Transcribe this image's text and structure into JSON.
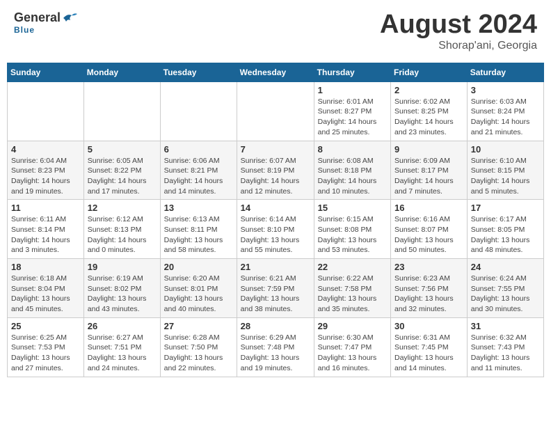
{
  "header": {
    "logo": {
      "general": "General",
      "blue": "Blue"
    },
    "title": "August 2024",
    "location": "Shorap'ani, Georgia"
  },
  "days_of_week": [
    "Sunday",
    "Monday",
    "Tuesday",
    "Wednesday",
    "Thursday",
    "Friday",
    "Saturday"
  ],
  "weeks": [
    [
      {
        "day": "",
        "info": ""
      },
      {
        "day": "",
        "info": ""
      },
      {
        "day": "",
        "info": ""
      },
      {
        "day": "",
        "info": ""
      },
      {
        "day": "1",
        "info": "Sunrise: 6:01 AM\nSunset: 8:27 PM\nDaylight: 14 hours\nand 25 minutes."
      },
      {
        "day": "2",
        "info": "Sunrise: 6:02 AM\nSunset: 8:25 PM\nDaylight: 14 hours\nand 23 minutes."
      },
      {
        "day": "3",
        "info": "Sunrise: 6:03 AM\nSunset: 8:24 PM\nDaylight: 14 hours\nand 21 minutes."
      }
    ],
    [
      {
        "day": "4",
        "info": "Sunrise: 6:04 AM\nSunset: 8:23 PM\nDaylight: 14 hours\nand 19 minutes."
      },
      {
        "day": "5",
        "info": "Sunrise: 6:05 AM\nSunset: 8:22 PM\nDaylight: 14 hours\nand 17 minutes."
      },
      {
        "day": "6",
        "info": "Sunrise: 6:06 AM\nSunset: 8:21 PM\nDaylight: 14 hours\nand 14 minutes."
      },
      {
        "day": "7",
        "info": "Sunrise: 6:07 AM\nSunset: 8:19 PM\nDaylight: 14 hours\nand 12 minutes."
      },
      {
        "day": "8",
        "info": "Sunrise: 6:08 AM\nSunset: 8:18 PM\nDaylight: 14 hours\nand 10 minutes."
      },
      {
        "day": "9",
        "info": "Sunrise: 6:09 AM\nSunset: 8:17 PM\nDaylight: 14 hours\nand 7 minutes."
      },
      {
        "day": "10",
        "info": "Sunrise: 6:10 AM\nSunset: 8:15 PM\nDaylight: 14 hours\nand 5 minutes."
      }
    ],
    [
      {
        "day": "11",
        "info": "Sunrise: 6:11 AM\nSunset: 8:14 PM\nDaylight: 14 hours\nand 3 minutes."
      },
      {
        "day": "12",
        "info": "Sunrise: 6:12 AM\nSunset: 8:13 PM\nDaylight: 14 hours\nand 0 minutes."
      },
      {
        "day": "13",
        "info": "Sunrise: 6:13 AM\nSunset: 8:11 PM\nDaylight: 13 hours\nand 58 minutes."
      },
      {
        "day": "14",
        "info": "Sunrise: 6:14 AM\nSunset: 8:10 PM\nDaylight: 13 hours\nand 55 minutes."
      },
      {
        "day": "15",
        "info": "Sunrise: 6:15 AM\nSunset: 8:08 PM\nDaylight: 13 hours\nand 53 minutes."
      },
      {
        "day": "16",
        "info": "Sunrise: 6:16 AM\nSunset: 8:07 PM\nDaylight: 13 hours\nand 50 minutes."
      },
      {
        "day": "17",
        "info": "Sunrise: 6:17 AM\nSunset: 8:05 PM\nDaylight: 13 hours\nand 48 minutes."
      }
    ],
    [
      {
        "day": "18",
        "info": "Sunrise: 6:18 AM\nSunset: 8:04 PM\nDaylight: 13 hours\nand 45 minutes."
      },
      {
        "day": "19",
        "info": "Sunrise: 6:19 AM\nSunset: 8:02 PM\nDaylight: 13 hours\nand 43 minutes."
      },
      {
        "day": "20",
        "info": "Sunrise: 6:20 AM\nSunset: 8:01 PM\nDaylight: 13 hours\nand 40 minutes."
      },
      {
        "day": "21",
        "info": "Sunrise: 6:21 AM\nSunset: 7:59 PM\nDaylight: 13 hours\nand 38 minutes."
      },
      {
        "day": "22",
        "info": "Sunrise: 6:22 AM\nSunset: 7:58 PM\nDaylight: 13 hours\nand 35 minutes."
      },
      {
        "day": "23",
        "info": "Sunrise: 6:23 AM\nSunset: 7:56 PM\nDaylight: 13 hours\nand 32 minutes."
      },
      {
        "day": "24",
        "info": "Sunrise: 6:24 AM\nSunset: 7:55 PM\nDaylight: 13 hours\nand 30 minutes."
      }
    ],
    [
      {
        "day": "25",
        "info": "Sunrise: 6:25 AM\nSunset: 7:53 PM\nDaylight: 13 hours\nand 27 minutes."
      },
      {
        "day": "26",
        "info": "Sunrise: 6:27 AM\nSunset: 7:51 PM\nDaylight: 13 hours\nand 24 minutes."
      },
      {
        "day": "27",
        "info": "Sunrise: 6:28 AM\nSunset: 7:50 PM\nDaylight: 13 hours\nand 22 minutes."
      },
      {
        "day": "28",
        "info": "Sunrise: 6:29 AM\nSunset: 7:48 PM\nDaylight: 13 hours\nand 19 minutes."
      },
      {
        "day": "29",
        "info": "Sunrise: 6:30 AM\nSunset: 7:47 PM\nDaylight: 13 hours\nand 16 minutes."
      },
      {
        "day": "30",
        "info": "Sunrise: 6:31 AM\nSunset: 7:45 PM\nDaylight: 13 hours\nand 14 minutes."
      },
      {
        "day": "31",
        "info": "Sunrise: 6:32 AM\nSunset: 7:43 PM\nDaylight: 13 hours\nand 11 minutes."
      }
    ]
  ]
}
